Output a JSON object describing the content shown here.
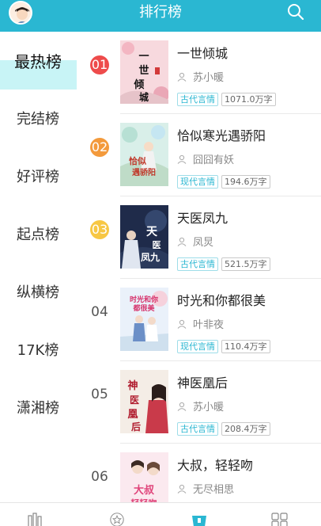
{
  "header": {
    "title": "排行榜"
  },
  "sidebar": {
    "items": [
      {
        "label": "最热榜",
        "active": true
      },
      {
        "label": "完结榜"
      },
      {
        "label": "好评榜"
      },
      {
        "label": "起点榜"
      },
      {
        "label": "纵横榜"
      },
      {
        "label": "17K榜"
      },
      {
        "label": "潇湘榜"
      }
    ]
  },
  "books": [
    {
      "rank": "01",
      "title": "一世倾城",
      "author": "苏小暖",
      "genre": "古代言情",
      "words": "1071.0万字",
      "cover_text": "一世倾城"
    },
    {
      "rank": "02",
      "title": "恰似寒光遇骄阳",
      "author": "囧囧有妖",
      "genre": "现代言情",
      "words": "194.6万字",
      "cover_text": "恰似寒光遇骄阳"
    },
    {
      "rank": "03",
      "title": "天医凤九",
      "author": "凤炅",
      "genre": "古代言情",
      "words": "521.5万字",
      "cover_text": "天医凤九"
    },
    {
      "rank": "04",
      "title": "时光和你都很美",
      "author": "叶非夜",
      "genre": "现代言情",
      "words": "110.4万字",
      "cover_text": "时光和你都很美"
    },
    {
      "rank": "05",
      "title": "神医凰后",
      "author": "苏小暖",
      "genre": "古代言情",
      "words": "208.4万字",
      "cover_text": "神医凰后"
    },
    {
      "rank": "06",
      "title": "大叔，轻轻吻",
      "author": "无尽相思",
      "genre": "",
      "words": "",
      "cover_text": "大叔轻轻吻"
    }
  ],
  "colors": {
    "accent": "#2ab7d2",
    "rank1": "#ee4b4b",
    "rank2": "#f39a3c",
    "rank3": "#f7c744",
    "sidebar_highlight": "#c8f4f6"
  },
  "icons": {
    "header": [
      "avatar",
      "search-icon"
    ],
    "bottom_tabs": [
      "bookshelf-icon",
      "star-icon",
      "ranking-icon",
      "category-icon"
    ]
  }
}
